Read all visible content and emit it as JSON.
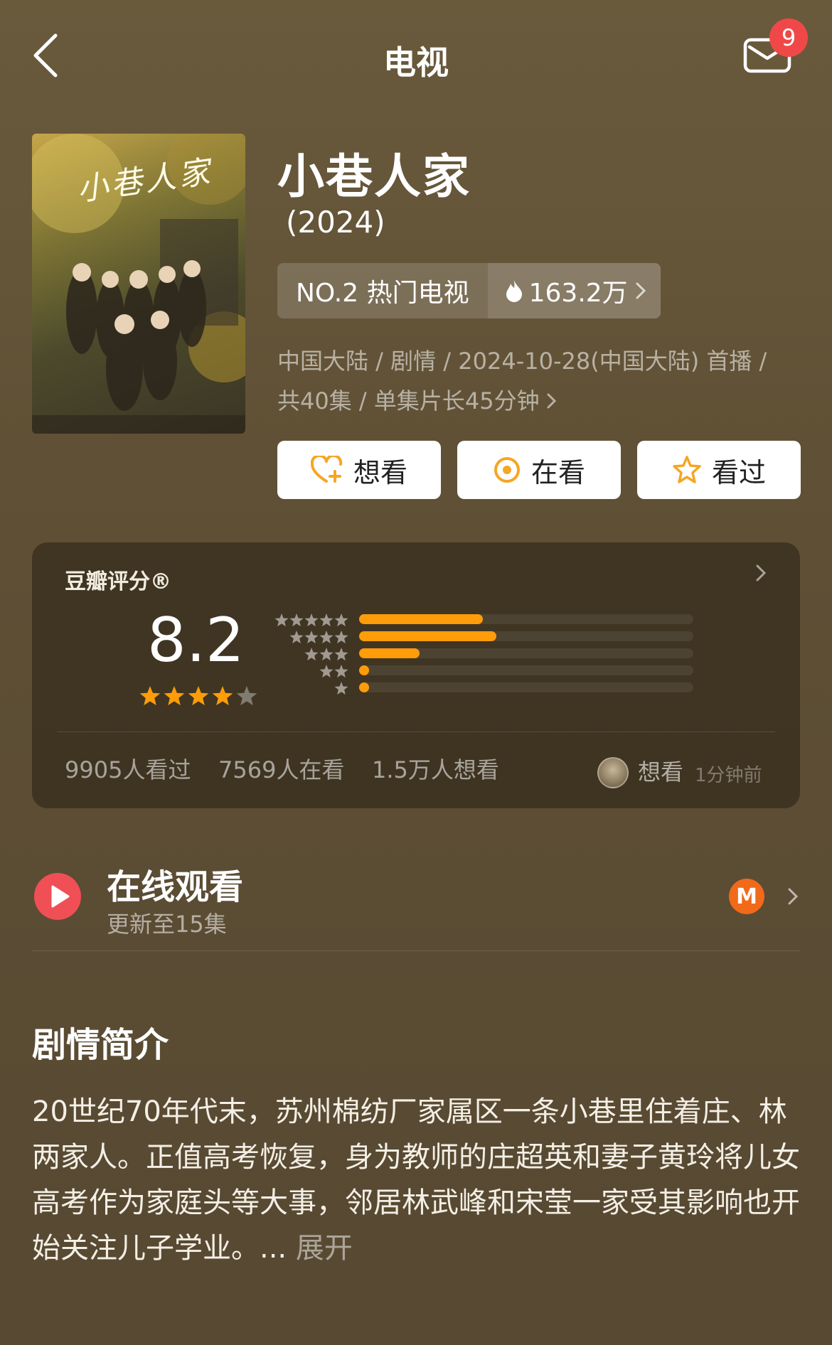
{
  "header": {
    "title": "电视",
    "badge_count": "9"
  },
  "movie": {
    "title": "小巷人家",
    "year": "(2024)",
    "rank_label": "NO.2 热门电视",
    "heat": "163.2万",
    "meta_line1": "中国大陆 / 剧情 / 2024-10-28(中国大陆) 首播 /",
    "meta_line2": "共40集 / 单集片长45分钟",
    "poster_title": "小巷人家"
  },
  "actions": {
    "want": "想看",
    "watching": "在看",
    "watched": "看过"
  },
  "rating": {
    "title": "豆瓣评分®",
    "score": "8.2",
    "stars": 4,
    "distribution": [
      {
        "stars": 5,
        "percent": 37
      },
      {
        "stars": 4,
        "percent": 41
      },
      {
        "stars": 3,
        "percent": 18
      },
      {
        "stars": 2,
        "percent": 3
      },
      {
        "stars": 1,
        "percent": 3
      }
    ],
    "watched_count": "9905人看过",
    "watching_count": "7569人在看",
    "want_count": "1.5万人想看",
    "activity_label": "想看",
    "activity_time": "1分钟前"
  },
  "online": {
    "title": "在线观看",
    "subtitle": "更新至15集"
  },
  "synopsis": {
    "title": "剧情简介",
    "text": "20世纪70年代末，苏州棉纺厂家属区一条小巷里住着庄、林两家人。正值高考恢复，身为教师的庄超英和妻子黄玲将儿女高考作为家庭头等大事，邻居林武峰和宋莹一家受其影响也开始关注儿子学业。...",
    "expand": "展开"
  },
  "colors": {
    "accent_orange": "#ff9c0a",
    "play_red": "#f04f55",
    "badge_red": "#f04848"
  }
}
